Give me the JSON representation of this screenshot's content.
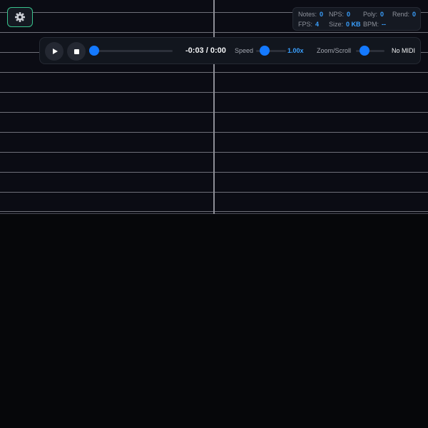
{
  "settings": {
    "icon": "gear-icon"
  },
  "stats": {
    "notes": {
      "label": "Notes:",
      "value": "0"
    },
    "nps": {
      "label": "NPS:",
      "value": "0"
    },
    "poly": {
      "label": "Poly:",
      "value": "0"
    },
    "rend": {
      "label": "Rend:",
      "value": "0"
    },
    "fps": {
      "label": "FPS:",
      "value": "4"
    },
    "size": {
      "label": "Size:",
      "value": "0 KB"
    },
    "bpm": {
      "label": "BPM:",
      "value": "--"
    }
  },
  "transport": {
    "play_icon": "play-icon",
    "stop_icon": "stop-icon",
    "seek_progress": 0,
    "time": "-0:03 / 0:00",
    "speed_label": "Speed",
    "speed_value": "1.00x",
    "zoom_label": "Zoom/Scroll",
    "midi_status": "No MIDI"
  },
  "colors": {
    "accent": "#1479ff",
    "stat_value": "#3aa0ff",
    "settings_border": "#38c38c",
    "roll_background": "#0b0c14",
    "page_background": "#06070a"
  }
}
